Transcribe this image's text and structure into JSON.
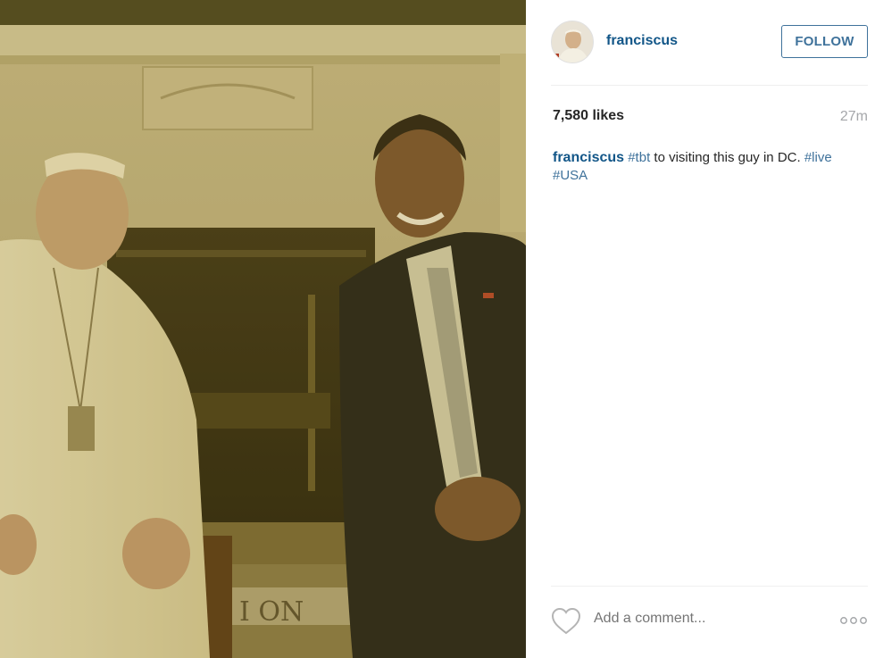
{
  "post": {
    "username": "franciscus",
    "follow_label": "FOLLOW",
    "likes_text": "7,580 likes",
    "timestamp": "27m",
    "caption": {
      "username": "franciscus",
      "tag_tbt": "#tbt",
      "text": " to visiting this guy in DC. ",
      "tag_live": "#live",
      "tag_usa": "#USA"
    },
    "comment_placeholder": "Add a comment...",
    "photo_rug_text": "I ON"
  },
  "colors": {
    "link_blue": "#125688",
    "tag_blue": "#3f729b",
    "follow_border": "#3f729b",
    "muted_text": "#a5a7aa",
    "photo_tint": "#6b5a2c"
  },
  "icons": [
    "avatar",
    "heart-icon",
    "more-options-icon"
  ]
}
